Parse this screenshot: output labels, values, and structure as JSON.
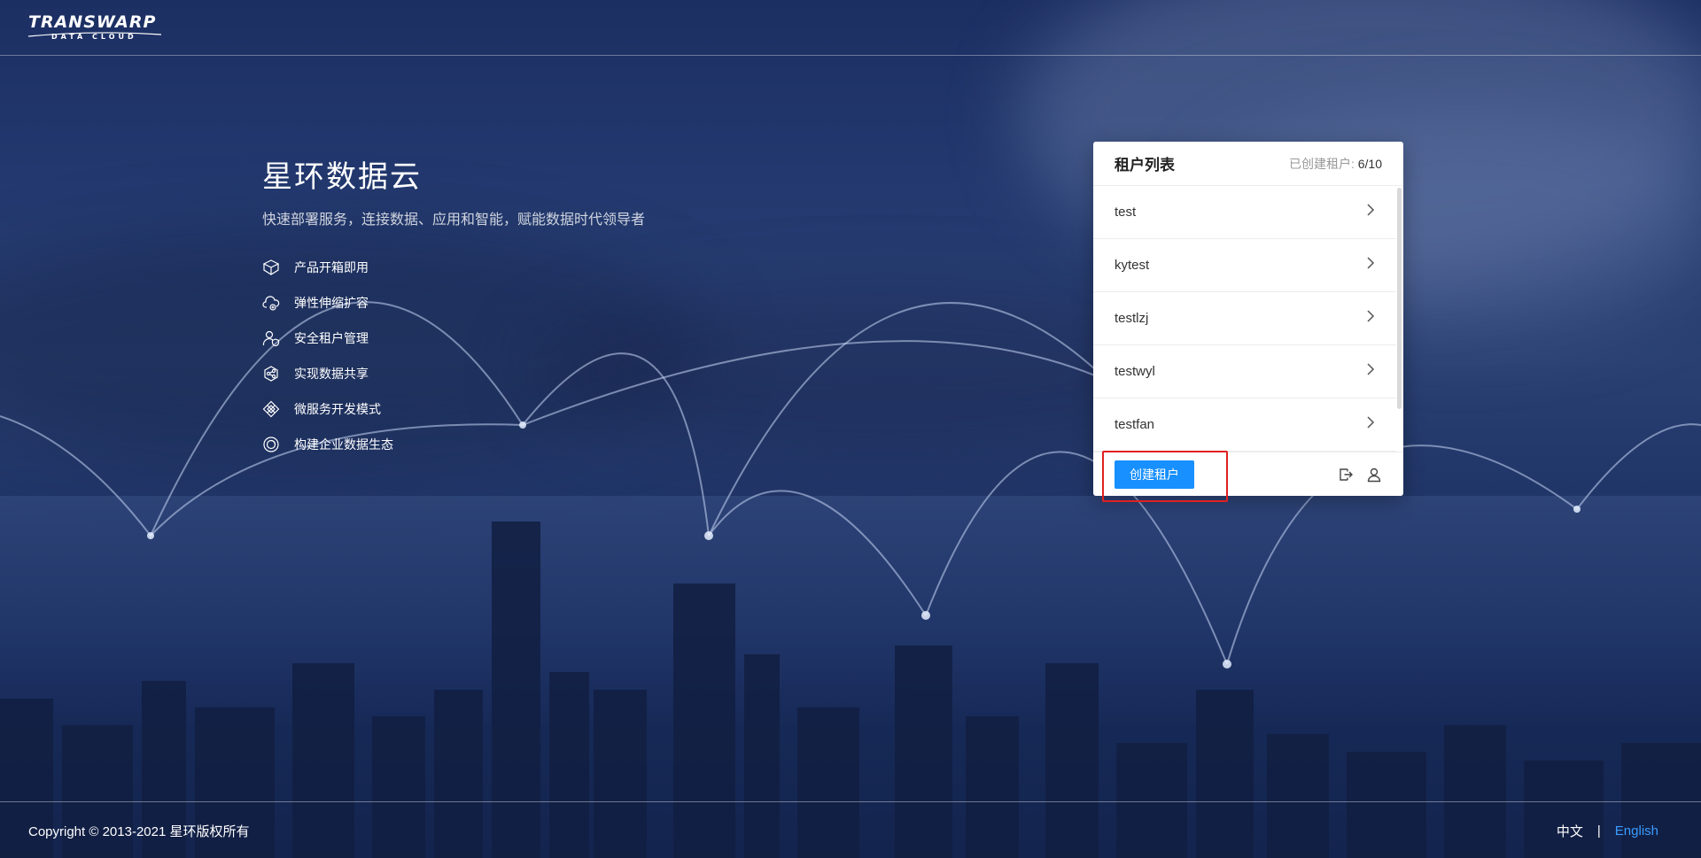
{
  "brand": {
    "logo_main": "TRANSWARP",
    "logo_sub": "DATA CLOUD"
  },
  "intro": {
    "title": "星环数据云",
    "subtitle": "快速部署服务，连接数据、应用和智能，赋能数据时代领导者",
    "features": [
      {
        "icon": "cube-icon",
        "label": "产品开箱即用"
      },
      {
        "icon": "cloud-scale-icon",
        "label": "弹性伸缩扩容"
      },
      {
        "icon": "user-shield-icon",
        "label": "安全租户管理"
      },
      {
        "icon": "share-icon",
        "label": "实现数据共享"
      },
      {
        "icon": "microservice-icon",
        "label": "微服务开发模式"
      },
      {
        "icon": "ecosystem-icon",
        "label": "构建企业数据生态"
      }
    ]
  },
  "tenant_panel": {
    "title": "租户列表",
    "count_label": "已创建租户:",
    "count_value": "6/10",
    "tenants": [
      "test",
      "kytest",
      "testlzj",
      "testwyl",
      "testfan"
    ],
    "create_button": "创建租户"
  },
  "footer": {
    "copyright": "Copyright © 2013-2021 星环版权所有",
    "lang_zh": "中文",
    "lang_sep": "|",
    "lang_en": "English"
  },
  "colors": {
    "primary": "#1890ff",
    "link": "#3a9cff",
    "highlight": "#e02020"
  }
}
